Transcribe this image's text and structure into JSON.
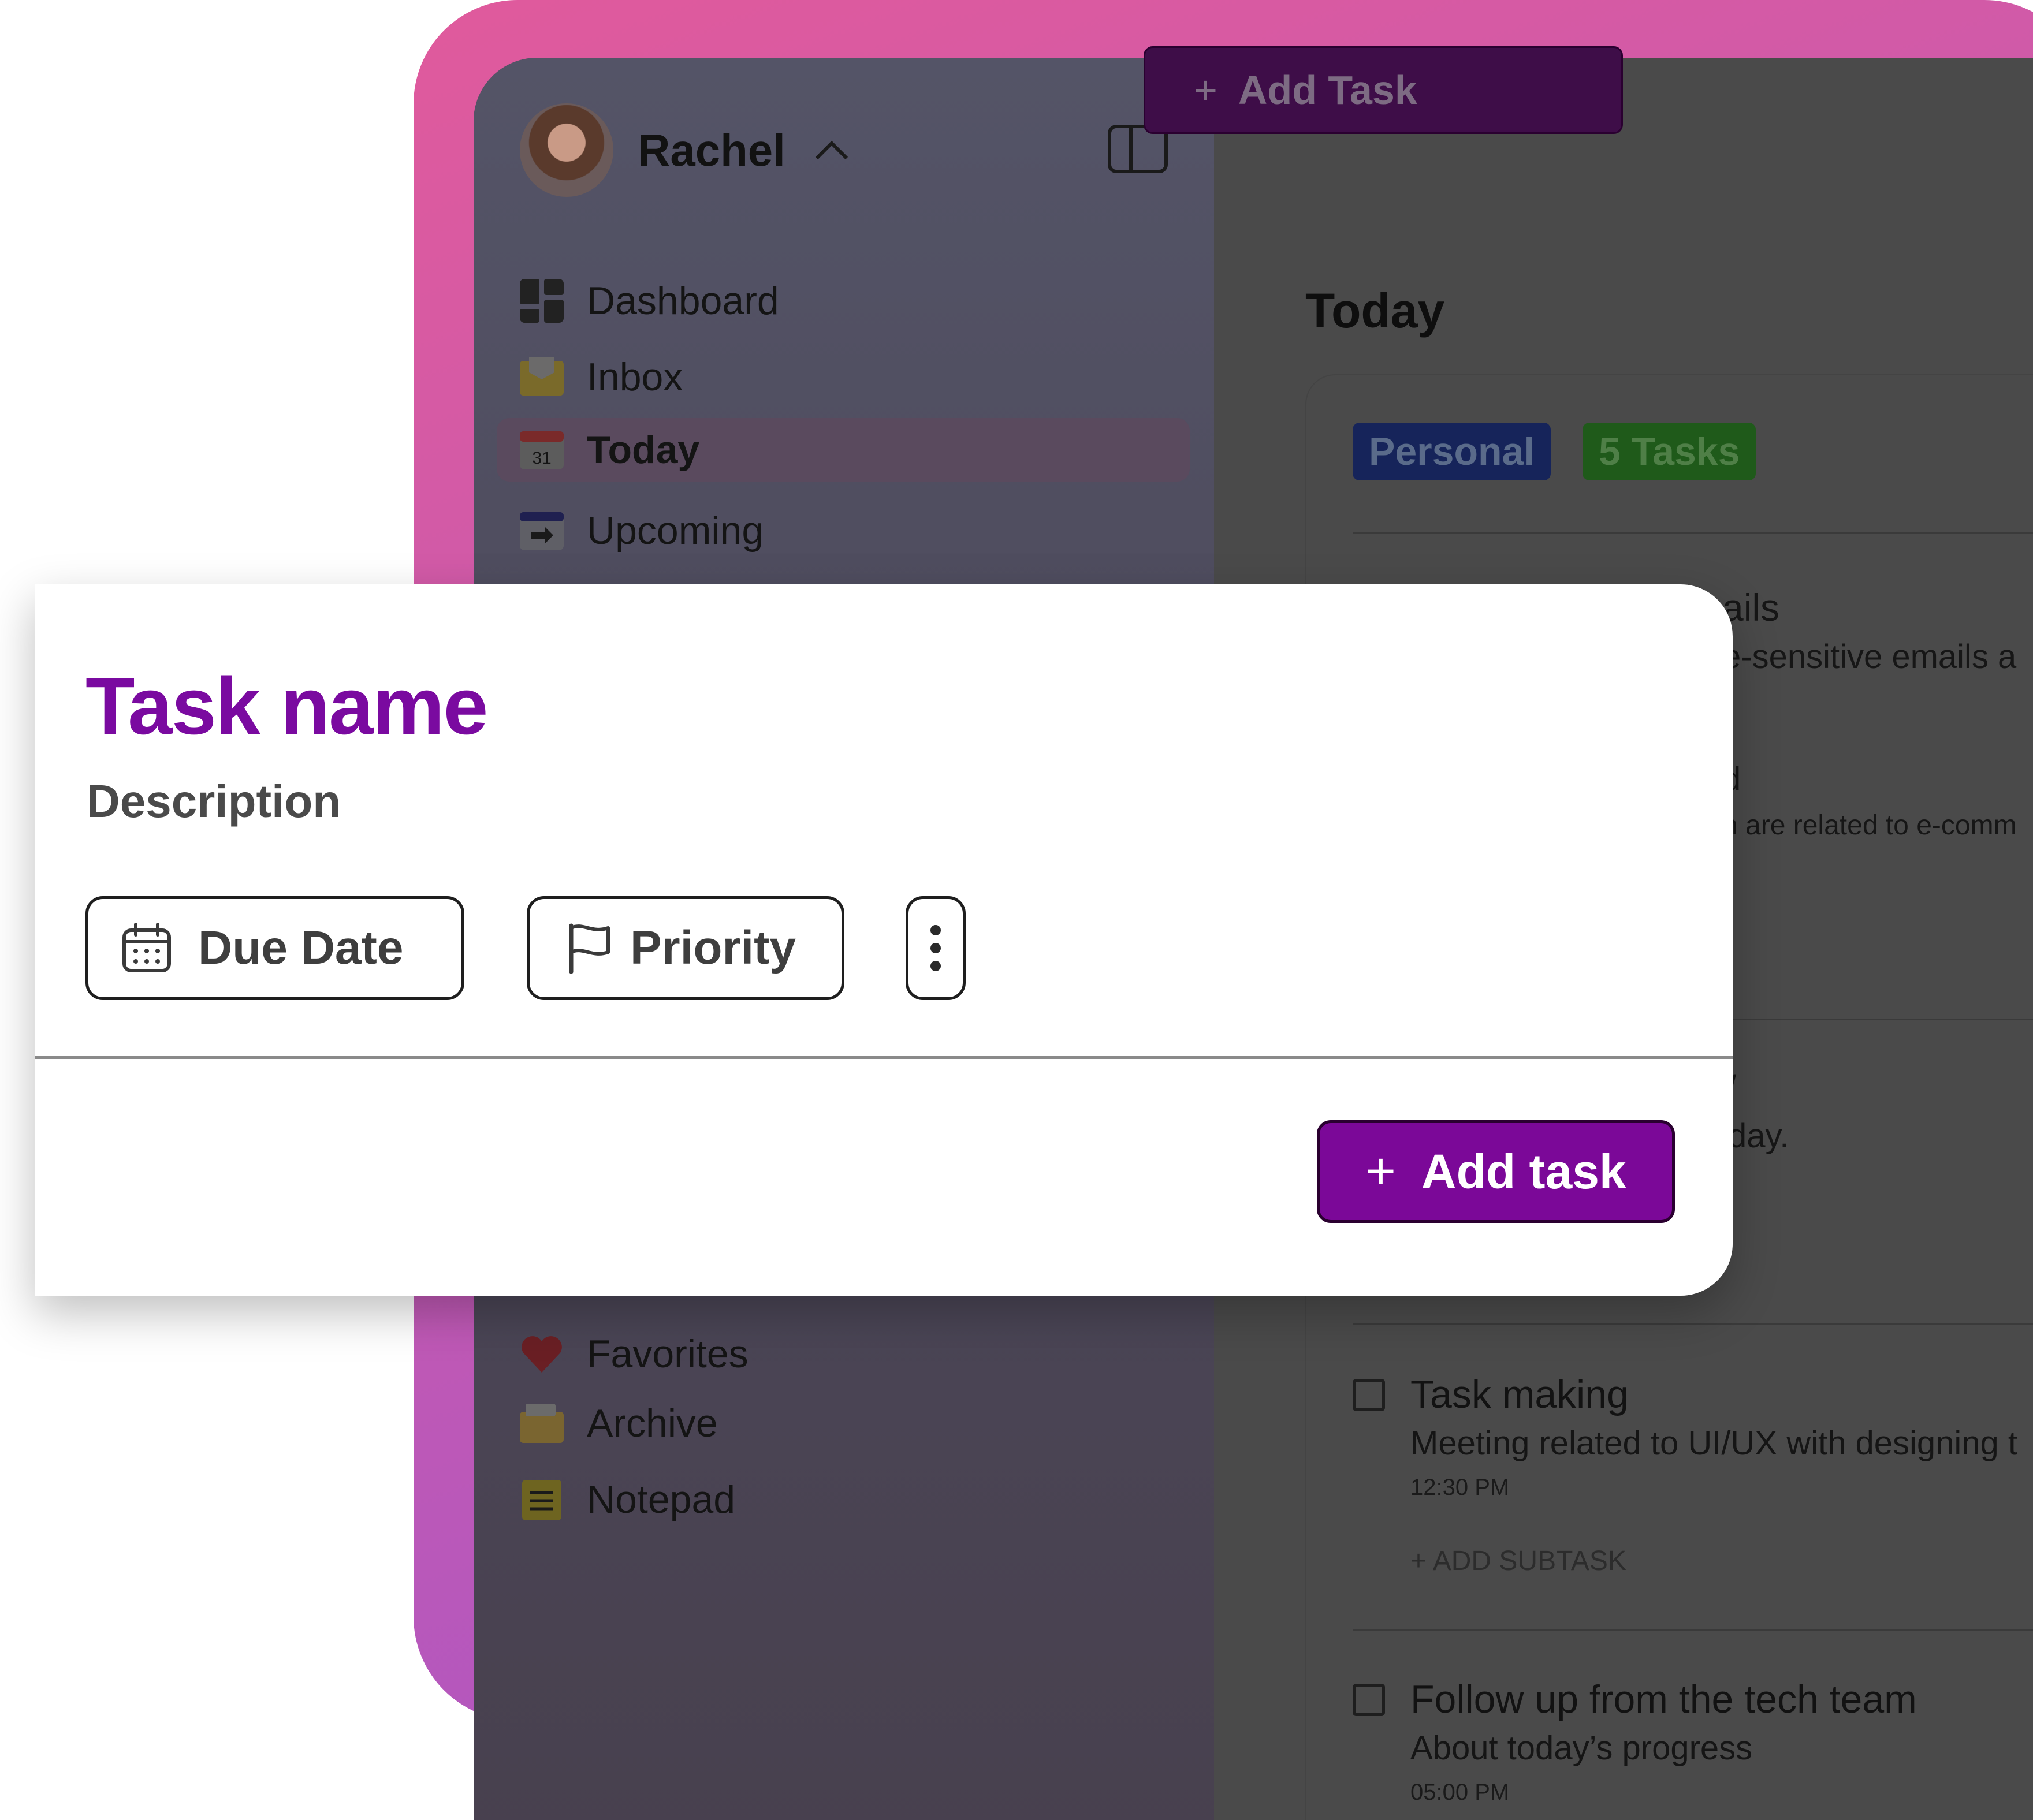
{
  "user": {
    "name": "Rachel"
  },
  "sidebar": {
    "items": [
      {
        "label": "Dashboard",
        "icon": "dashboard-icon"
      },
      {
        "label": "Inbox",
        "icon": "inbox-icon"
      },
      {
        "label": "Today",
        "icon": "calendar-31-icon",
        "icon_text": "31",
        "active": true
      },
      {
        "label": "Upcoming",
        "icon": "calendar-upcoming-icon"
      },
      {
        "label": "Favorites",
        "icon": "heart-icon"
      },
      {
        "label": "Archive",
        "icon": "archive-icon"
      },
      {
        "label": "Notepad",
        "icon": "notepad-icon"
      }
    ]
  },
  "toolbar": {
    "add_task_label": "Add Task",
    "plus": "+"
  },
  "main": {
    "title": "Today",
    "badges": {
      "personal": "Personal",
      "count": "5 Tasks"
    },
    "partial_text": {
      "line1": "ails",
      "line2": "e-sensitive emails a",
      "line3": "d",
      "line4": "h are related to e-comm",
      "line5": "day.",
      "line6": "/"
    },
    "tasks": [
      {
        "title": "Task making",
        "description": "Meeting related to UI/UX with designing t",
        "time": "12:30 PM",
        "subtask_label": "+ ADD SUBTASK"
      },
      {
        "title": "Follow up from the tech team",
        "description": "About today’s progress",
        "time": "05:00 PM"
      }
    ]
  },
  "modal": {
    "title": "Task name",
    "description": "Description",
    "due_date_label": "Due Date",
    "priority_label": "Priority",
    "add_button_label": "Add task",
    "plus": "+"
  },
  "colors": {
    "accent": "#7b0898",
    "title_purple": "#7a0aa0",
    "gradient_start": "#e05a9c",
    "gradient_end": "#a655c8",
    "overlay": "#4a4a4a"
  }
}
